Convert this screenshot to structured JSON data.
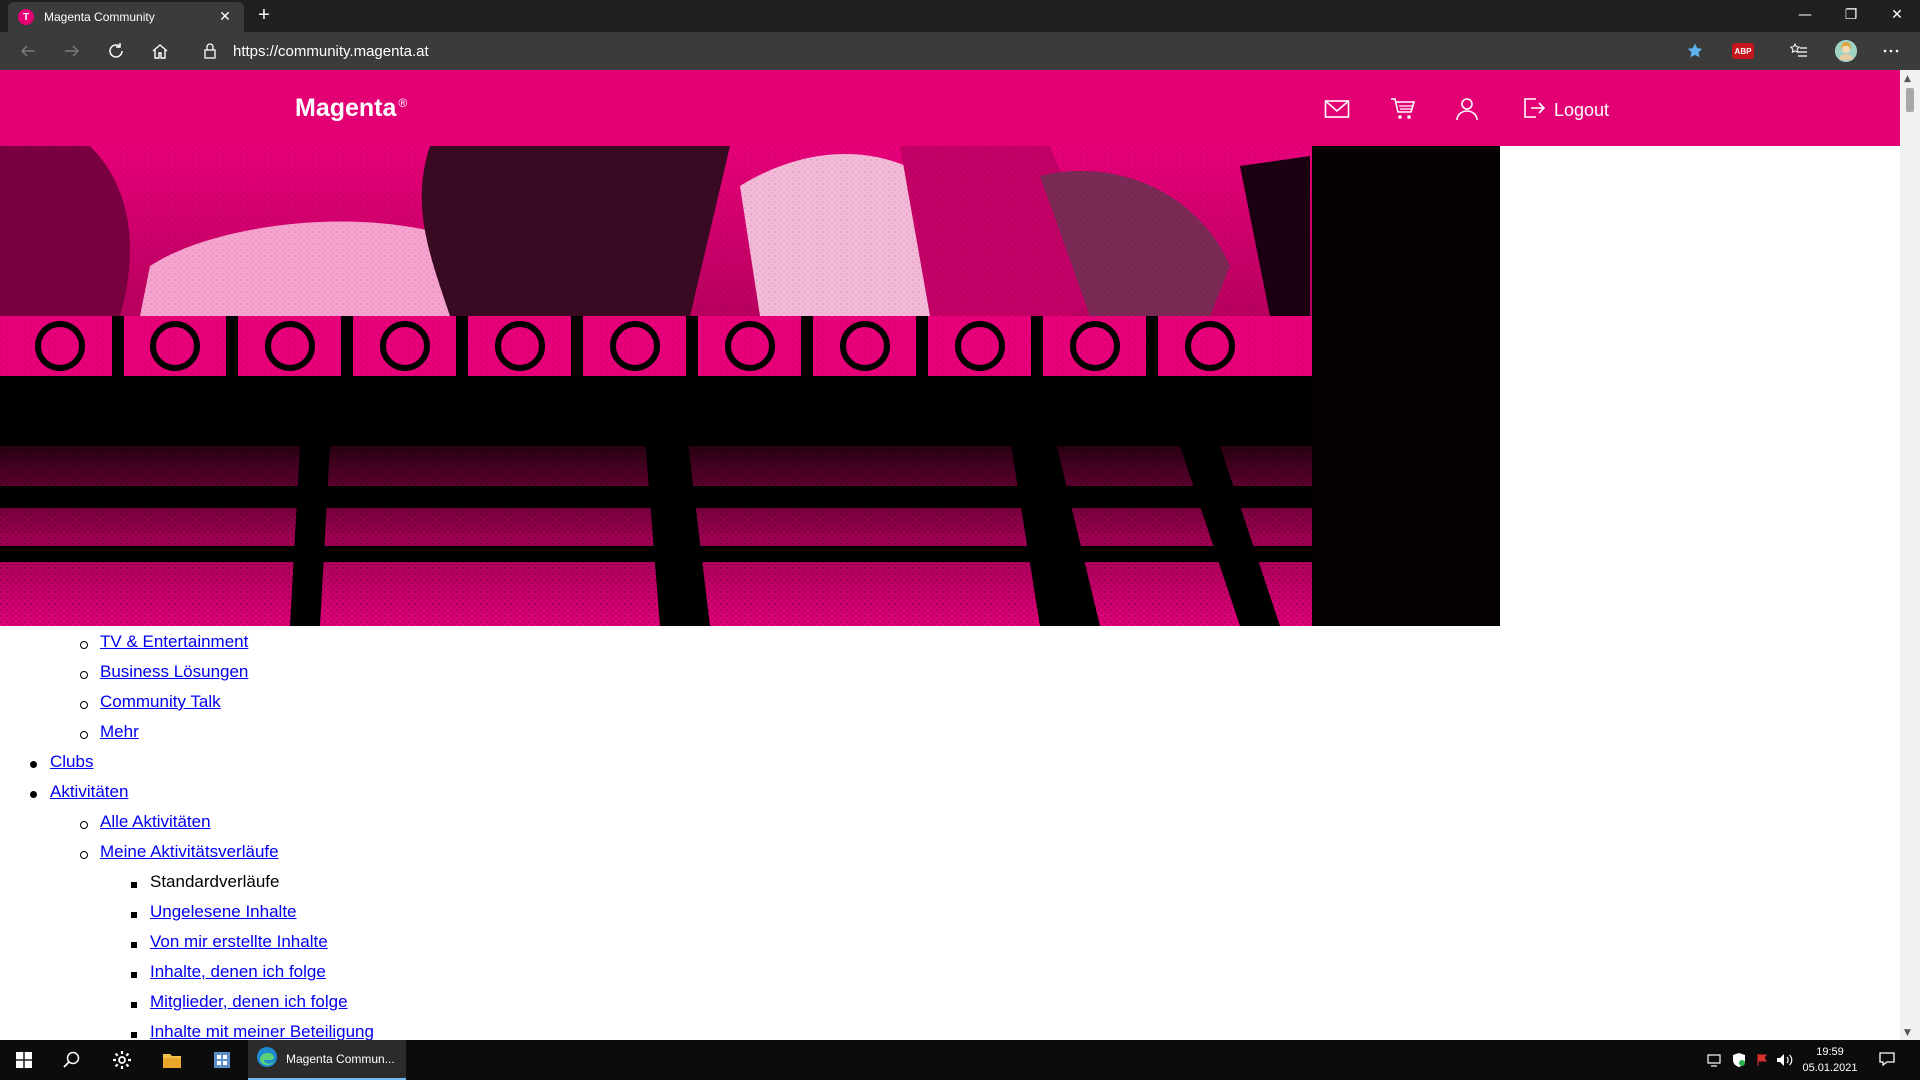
{
  "browser": {
    "tab_title": "Magenta Community",
    "url": "https://community.magenta.at",
    "adblock_label": "ABP"
  },
  "header": {
    "brand": "Magenta",
    "brand_mark": "®",
    "logout_label": "Logout"
  },
  "menu": {
    "items": [
      {
        "label": "TV & Entertainment",
        "level": 2,
        "link": true
      },
      {
        "label": "Business Lösungen",
        "level": 2,
        "link": true
      },
      {
        "label": "Community Talk",
        "level": 2,
        "link": true
      },
      {
        "label": "Mehr",
        "level": 2,
        "link": true
      },
      {
        "label": "Clubs",
        "level": 1,
        "link": true
      },
      {
        "label": "Aktivitäten",
        "level": 1,
        "link": true
      },
      {
        "label": "Alle Aktivitäten",
        "level": 2,
        "link": true
      },
      {
        "label": "Meine Aktivitätsverläufe",
        "level": 2,
        "link": true
      },
      {
        "label": "Standardverläufe",
        "level": 3,
        "link": false
      },
      {
        "label": "Ungelesene Inhalte",
        "level": 3,
        "link": true
      },
      {
        "label": "Von mir erstellte Inhalte",
        "level": 3,
        "link": true
      },
      {
        "label": "Inhalte, denen ich folge",
        "level": 3,
        "link": true
      },
      {
        "label": "Mitglieder, denen ich folge",
        "level": 3,
        "link": true
      },
      {
        "label": "Inhalte mit meiner Beteiligung",
        "level": 3,
        "link": true
      }
    ]
  },
  "taskbar": {
    "active_app_label": "Magenta Commun...",
    "time": "19:59",
    "date": "05.01.2021"
  },
  "colors": {
    "brand": "#e20074",
    "link": "#0000ee",
    "chrome_dark": "#202020",
    "chrome_mid": "#3b3b3b"
  }
}
